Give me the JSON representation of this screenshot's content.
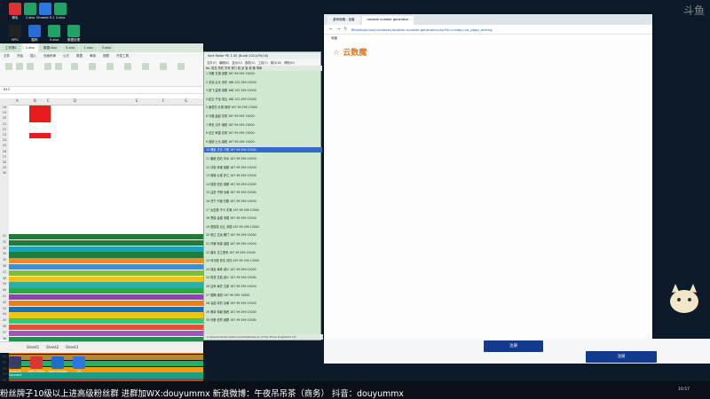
{
  "desktop": {
    "icons_top": [
      {
        "label": "鹅毛",
        "color": "#d33"
      },
      {
        "label": "1.xlsx",
        "color": "#21a366"
      },
      {
        "label": "Chrome 0.1",
        "color": "#2b78e4"
      },
      {
        "label": "2.xlsx",
        "color": "#21a366"
      },
      {
        "label": "EPIC",
        "color": "#222"
      },
      {
        "label": "酷狗",
        "color": "#2b6bd6"
      },
      {
        "label": "5.xlsx",
        "color": "#21a366"
      },
      {
        "label": "数据处理",
        "color": "#21a366"
      }
    ],
    "icons_bottom": [
      {
        "label": "Ubisoft Connect",
        "color": "#3c3c6a"
      },
      {
        "label": "WPS Office",
        "color": "#d33"
      },
      {
        "label": "TeamViewer",
        "color": "#1b6fd1"
      },
      {
        "label": "VR",
        "color": "#2b78e4"
      }
    ]
  },
  "excel": {
    "tabs": [
      "工作簿1",
      "2.xlsx",
      "数据.xlsx",
      "5.xlsx",
      "1.xlsx",
      "3.xlsx"
    ],
    "menu": [
      "文件",
      "开始",
      "插入",
      "页面布局",
      "公式",
      "数据",
      "审阅",
      "视图",
      "开发工具"
    ],
    "name_box": "B43",
    "columns": [
      "A",
      "B",
      "C",
      "D",
      "E",
      "F",
      "G"
    ],
    "rows_top": [
      18,
      19,
      20,
      21,
      22,
      23,
      24,
      25,
      26,
      27,
      28,
      29,
      30
    ],
    "rows_colored": [
      31,
      32,
      33,
      34,
      35,
      36,
      37,
      38,
      39,
      40,
      41,
      42,
      43,
      44,
      45,
      46,
      47,
      48,
      49,
      50,
      51,
      52,
      53,
      54,
      55
    ],
    "sheets": [
      "Sheet1",
      "Sheet2",
      "Sheet3"
    ]
  },
  "listwin": {
    "title": "Sort Roller PE 1.00 (Build 2021/09/16)",
    "menu": [
      "文件(F)",
      "编辑(E)",
      "显示(V)",
      "选项(O)",
      "工具(T)",
      "窗口(W)",
      "帮助(H)"
    ],
    "header": "No. 姓名 所在 字号 势力 统 武 智 政 魅 寿命",
    "rows": [
      "1  刘备 玄德 涿郡 167 99 299 13000",
      "2  关羽 云长 河东 168 101 299 13000",
      "3  张飞 益德 涿郡 168 101 299 13000",
      "4  赵云 子龙 常山 168 101 299 13000",
      "5  诸葛亮 孔明 琅邪 167 99 299 13000",
      "6  马超 孟起 扶风 167 99 299 13000",
      "7  黄忠 汉升 南阳 167 99 299 13000",
      "8  法正 孝直 扶风 167 99 299 13000",
      "9  庞统 士元 襄阳 167 99 299 13000",
      "10 魏延 文长 义阳 167 99 299 13000",
      "11 姜维 伯约 天水 167 99 299 13000",
      "12 孙权 仲谋 吴郡 167 99 299 13000",
      "13 周瑜 公瑾 庐江 167 99 299 13000",
      "14 陆逊 伯言 吴郡 167 99 299 13000",
      "15 吕蒙 子明 汝南 167 99 299 13000",
      "16 甘宁 兴霸 巴郡 167 99 299 13000",
      "17 太史慈 子义 东莱 167 99 299 13000",
      "18 曹操 孟德 沛国 167 99 299 13000",
      "19 夏侯惇 元让 沛国 167 99 299 13000",
      "20 张辽 文远 雁门 167 99 299 13000",
      "21 许褚 仲康 谯县 167 99 299 13000",
      "22 典韦 古之恶来 167 99 299 13000",
      "23 司马懿 仲达 河内 167 99 299 13000",
      "24 郭嘉 奉孝 颍川 167 99 299 13000",
      "25 荀彧 文若 颍川 167 99 299 13000",
      "26 吕布 奉先 五原 167 99 299 13000",
      "27 貂蝉 洛阳 167 99 299 13000",
      "28 袁绍 本初 汝南 167 99 299 13000",
      "29 董卓 仲颖 陇西 167 99 299 13000",
      "30 孙策 伯符 吴郡 167 99 299 13000"
    ],
    "selected_row": 9,
    "status": "C:\\Users\\romance\\Documents\\Romance of the Three Kingdoms 13\\"
  },
  "browser": {
    "tabs": [
      "游戏攻略 - 百度",
      "random number generator"
    ],
    "url": "fffcashao.com/numbers/random-number-generator.php?tk=ccdag=ca_popp_acmng",
    "bookmarks": "收藏",
    "logo": "☆ 云数魔"
  },
  "bottom": {
    "submit1": "注册",
    "submit2": "注册"
  },
  "banner": "粉丝牌子10级以上进高级粉丝群  进群加WX:douyummx 新浪微博：午夜吊吊茶（商务）    抖音：douyummx",
  "clock": "10:57",
  "watermark": "斗鱼"
}
